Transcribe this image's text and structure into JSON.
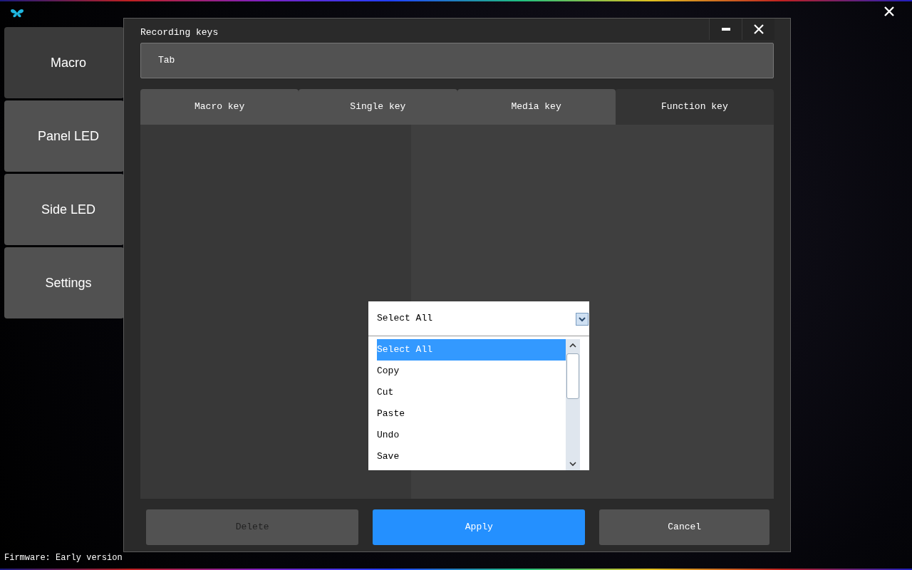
{
  "sidebar": {
    "items": [
      {
        "label": "Macro",
        "selected": true
      },
      {
        "label": "Panel LED",
        "selected": false
      },
      {
        "label": "Side LED",
        "selected": false
      },
      {
        "label": "Settings",
        "selected": false
      }
    ]
  },
  "dialog": {
    "title": "Recording keys",
    "recorded_key": "Tab",
    "tabs": [
      {
        "label": "Macro key",
        "selected": false
      },
      {
        "label": "Single key",
        "selected": false
      },
      {
        "label": "Media key",
        "selected": false
      },
      {
        "label": "Function key",
        "selected": true
      }
    ],
    "dropdown": {
      "value": "Select All",
      "expanded": true,
      "options": [
        {
          "label": "Select All",
          "selected": true
        },
        {
          "label": "Copy",
          "selected": false
        },
        {
          "label": "Cut",
          "selected": false
        },
        {
          "label": "Paste",
          "selected": false
        },
        {
          "label": "Undo",
          "selected": false
        },
        {
          "label": "Save",
          "selected": false
        }
      ]
    },
    "buttons": [
      {
        "label": "Delete",
        "kind": "secondary",
        "disabled": true
      },
      {
        "label": "Apply",
        "kind": "primary",
        "disabled": false
      },
      {
        "label": "Cancel",
        "kind": "secondary",
        "disabled": false
      }
    ]
  },
  "status_bar": {
    "firmware": "Firmware: Early version"
  }
}
